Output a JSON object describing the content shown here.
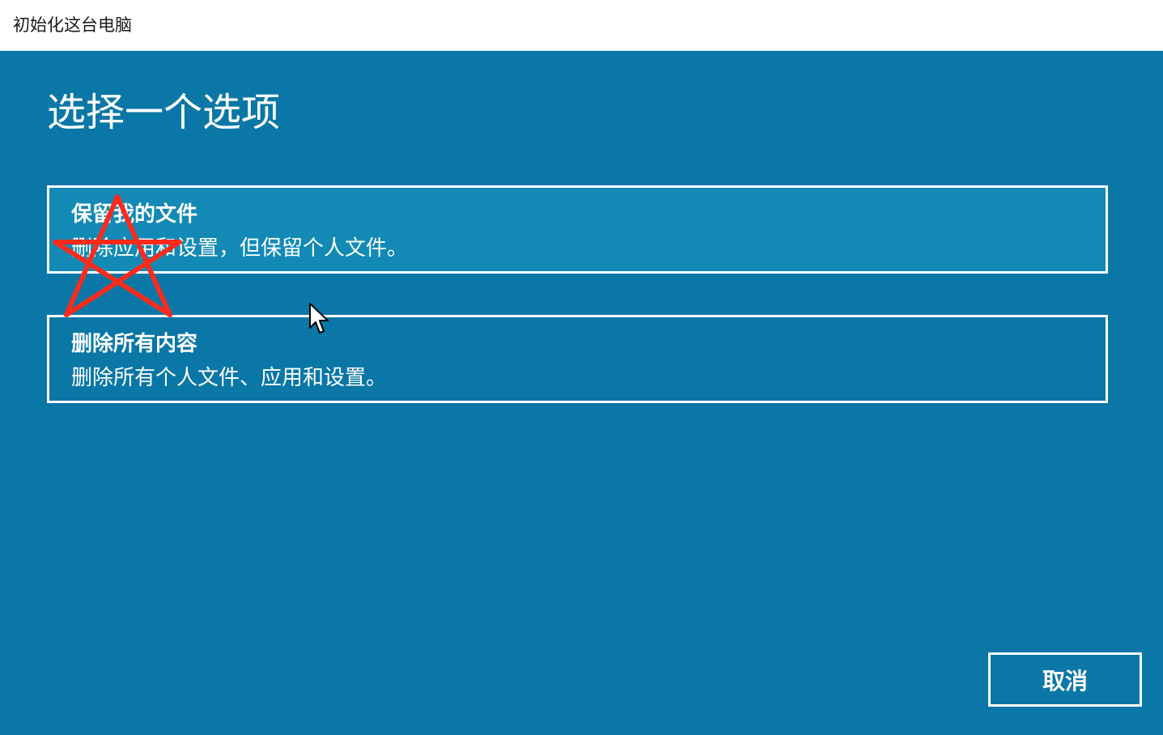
{
  "window": {
    "title": "初始化这台电脑"
  },
  "main": {
    "heading": "选择一个选项",
    "options": [
      {
        "title": "保留我的文件",
        "description": "删除应用和设置，但保留个人文件。",
        "hovered": true
      },
      {
        "title": "删除所有内容",
        "description": "删除所有个人文件、应用和设置。",
        "hovered": false
      }
    ],
    "cancel_label": "取消"
  },
  "colors": {
    "background": "#0a77a6",
    "hover_background": "#128ab5",
    "text": "#ffffff",
    "annotation": "#ff2a1a"
  },
  "icons": {
    "annotation": "star-annotation",
    "cursor": "mouse-pointer-icon"
  }
}
